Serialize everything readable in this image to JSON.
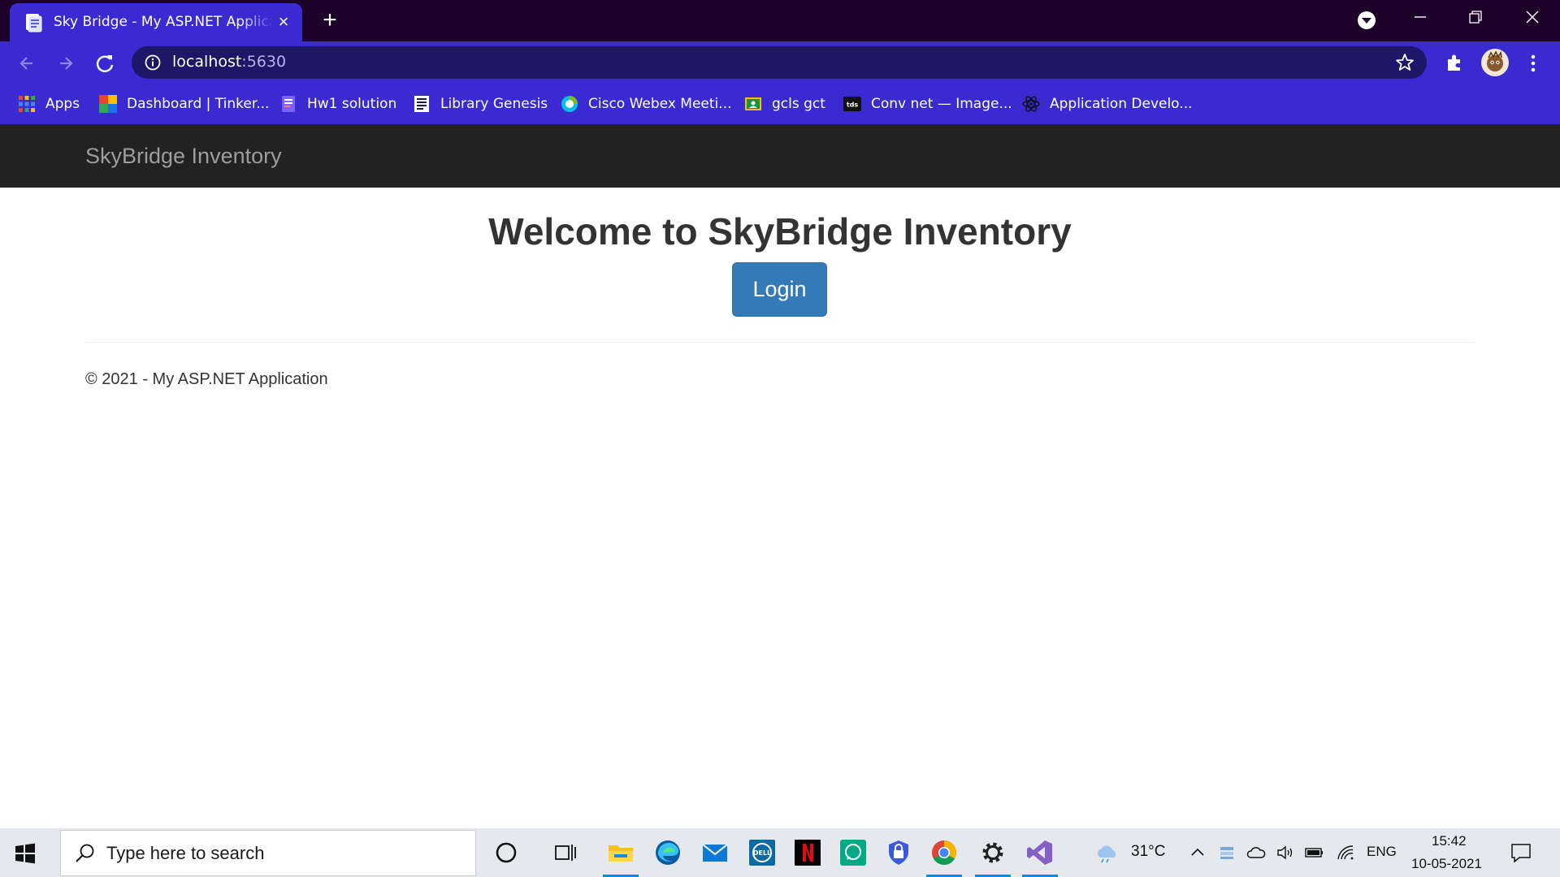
{
  "browser": {
    "tab_title": "Sky Bridge - My ASP.NET Application",
    "url_host": "localhost",
    "url_port": ":5630",
    "bookmarks": [
      {
        "label": "Apps",
        "icon": "apps-grid-icon"
      },
      {
        "label": "Dashboard | Tinker...",
        "icon": "tinkercad-icon"
      },
      {
        "label": "Hw1 solution",
        "icon": "document-icon"
      },
      {
        "label": "Library Genesis",
        "icon": "library-icon"
      },
      {
        "label": "Cisco Webex Meeti...",
        "icon": "webex-icon"
      },
      {
        "label": "gcls gct",
        "icon": "classroom-icon"
      },
      {
        "label": "Conv net — Image...",
        "icon": "tds-icon"
      },
      {
        "label": "Application Develo...",
        "icon": "app-dev-icon"
      }
    ]
  },
  "page": {
    "brand": "SkyBridge Inventory",
    "welcome": "Welcome to SkyBridge Inventory",
    "login_label": "Login",
    "footer": "© 2021 - My ASP.NET Application"
  },
  "taskbar": {
    "search_placeholder": "Type here to search",
    "temperature": "31°C",
    "language": "ENG",
    "time": "15:42",
    "date": "10-05-2021"
  },
  "colors": {
    "chrome_dark": "#1c0128",
    "chrome_accent": "#3a2ad1",
    "navbar": "#222222",
    "button_primary": "#337ab7"
  }
}
